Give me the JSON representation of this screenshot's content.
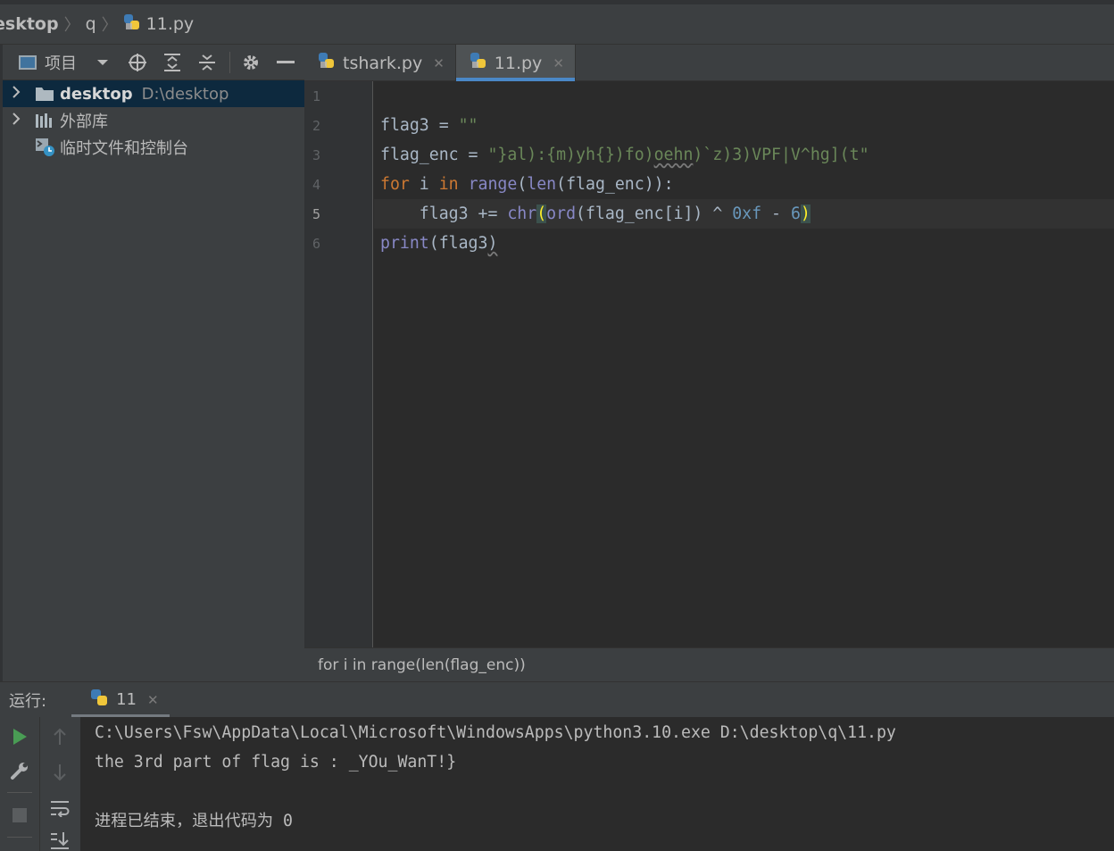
{
  "breadcrumb": {
    "items": [
      "esktop",
      "q",
      "11.py"
    ]
  },
  "project": {
    "toolbar_title": "项目",
    "tree": [
      {
        "label": "desktop",
        "path": "D:\\desktop"
      },
      {
        "label": "外部库"
      },
      {
        "label": "临时文件和控制台"
      }
    ]
  },
  "editor": {
    "tabs": [
      {
        "label": "tshark.py"
      },
      {
        "label": "11.py"
      }
    ],
    "line_numbers": [
      "1",
      "2",
      "3",
      "4",
      "5",
      "6"
    ],
    "code": {
      "l2_a": "flag3 = ",
      "l2_b": "\"\"",
      "l3_a": "flag_enc = ",
      "l3_s1": "\"}al):{m)yh{})fo)",
      "l3_s2": "oehn",
      "l3_s3": ")`z)3)VPF|V^hg](t\"",
      "l4_for": "for",
      "l4_i": " i ",
      "l4_in": "in",
      "l4_sp": " ",
      "l4_range": "range",
      "l4_p1": "(",
      "l4_len": "len",
      "l4_rest": "(flag_enc)):",
      "l5_a": "    flag3 += ",
      "l5_chr": "chr",
      "l5_open": "(",
      "l5_ord": "ord",
      "l5_mid": "(flag_enc[i]) ^ ",
      "l5_hex": "0xf",
      "l5_minus": " - ",
      "l5_six": "6",
      "l5_close": ")",
      "l6_print": "print",
      "l6_args": "(flag3",
      "l6_close": ")"
    },
    "status_crumb": "for i in range(len(flag_enc))"
  },
  "run": {
    "label": "运行:",
    "tab_label": "11",
    "console": [
      "C:\\Users\\Fsw\\AppData\\Local\\Microsoft\\WindowsApps\\python3.10.exe D:\\desktop\\q\\11.py",
      "the 3rd part of flag is : _YOu_WanT!}",
      "",
      "进程已结束，退出代码为 0"
    ]
  },
  "colors": {
    "keyword": "#cc7832",
    "builtin": "#8888c6",
    "string": "#6a8759",
    "number": "#6897bb",
    "accent": "#4a88c7"
  }
}
